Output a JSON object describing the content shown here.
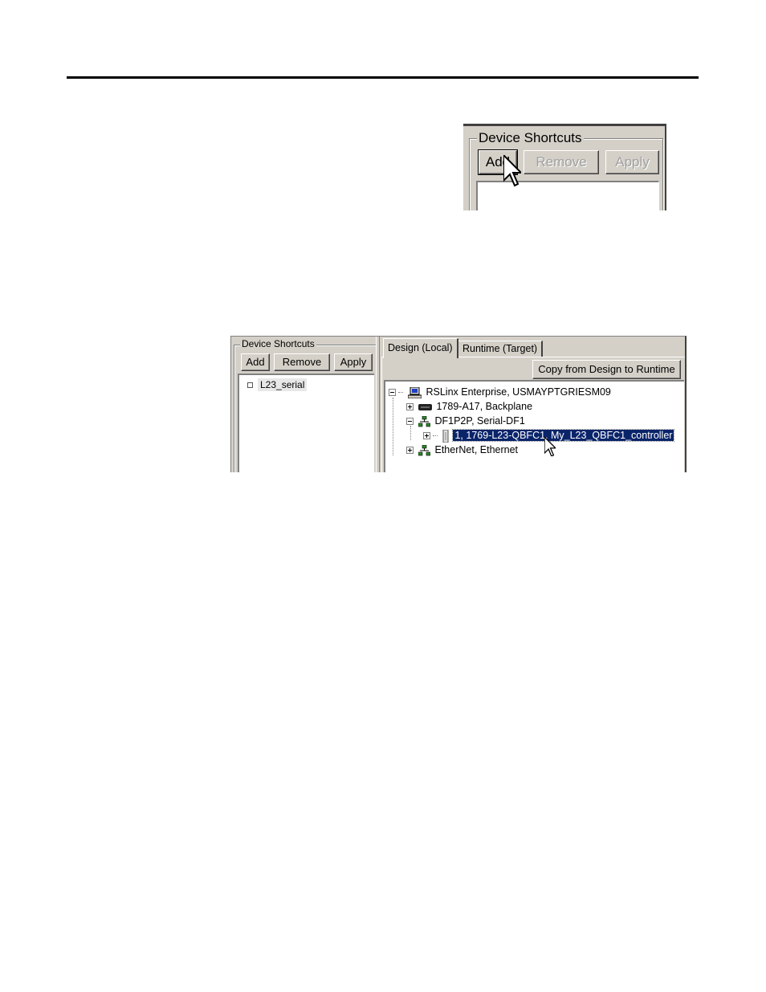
{
  "shot1": {
    "group_title": "Device Shortcuts",
    "add_label": "Add",
    "remove_label": "Remove",
    "apply_label": "Apply"
  },
  "shot2": {
    "group_title": "Device Shortcuts",
    "add_label": "Add",
    "remove_label": "Remove",
    "apply_label": "Apply",
    "shortcut_item": "L23_serial",
    "tabs": [
      {
        "label": "Design (Local)"
      },
      {
        "label": "Runtime (Target)"
      }
    ],
    "copy_label": "Copy from Design to Runtime",
    "tree": [
      {
        "label": "RSLinx Enterprise, USMAYPTGRIESM09",
        "icon": "computer-icon"
      },
      {
        "label": "1789-A17, Backplane",
        "icon": "backplane-icon"
      },
      {
        "label": "DF1P2P, Serial-DF1",
        "icon": "network-icon"
      },
      {
        "label": "1, 1769-L23-QBFC1, My_L23_QBFC1_controller",
        "icon": "controller-icon"
      },
      {
        "label": "EtherNet, Ethernet",
        "icon": "network-icon"
      }
    ]
  }
}
